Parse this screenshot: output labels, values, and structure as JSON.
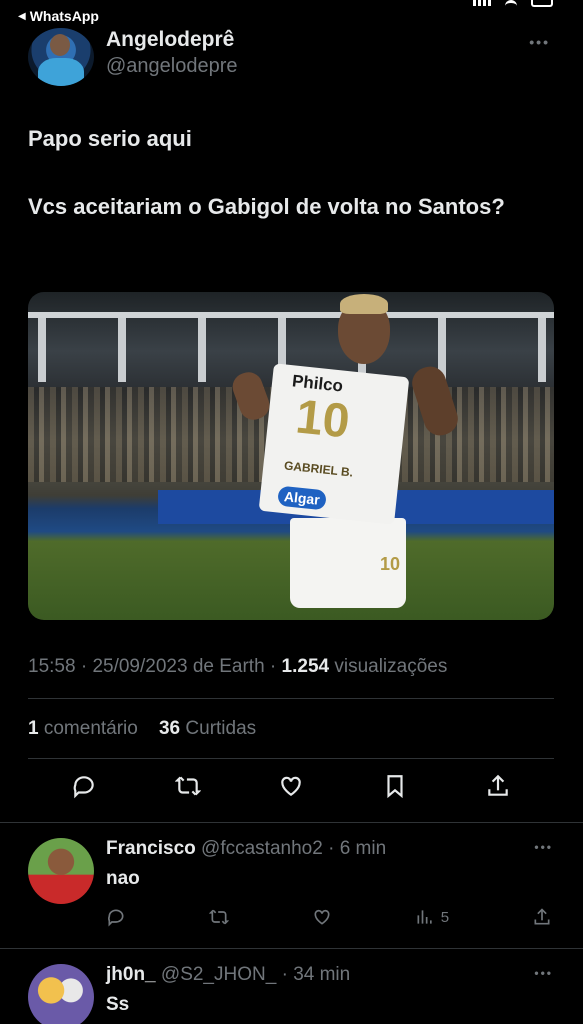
{
  "status_bar": {
    "back_app": "WhatsApp"
  },
  "tweet": {
    "display_name": "Angelodeprê",
    "handle": "@angelodepre",
    "text_lines": [
      "Papo serio aqui",
      "Vcs aceitariam o Gabigol de volta no Santos?"
    ],
    "media": {
      "shirt_brand": "Philco",
      "shirt_number": "10",
      "shirt_name": "GABRIEL B.",
      "shirt_sponsor": "Algar",
      "shorts_number": "10"
    },
    "time": "15:58",
    "date": "25/09/2023",
    "source": "de Earth",
    "views_count": "1.254",
    "views_label": "visualizações",
    "comments_count": "1",
    "comments_label": "comentário",
    "likes_count": "36",
    "likes_label": "Curtidas"
  },
  "actions": [
    "reply-icon",
    "retweet-icon",
    "like-icon",
    "bookmark-icon",
    "share-icon"
  ],
  "replies": [
    {
      "name": "Francisco",
      "handle": "@fccastanho2",
      "time": "6 min",
      "text": "nao",
      "views": "5"
    },
    {
      "name": "jh0n_",
      "handle": "@S2_JHON_",
      "time": "34 min",
      "text": "Ss"
    }
  ],
  "colors": {
    "background": "#000000",
    "text": "#e7e9ea",
    "muted": "#71767b",
    "divider": "#2f3336"
  }
}
